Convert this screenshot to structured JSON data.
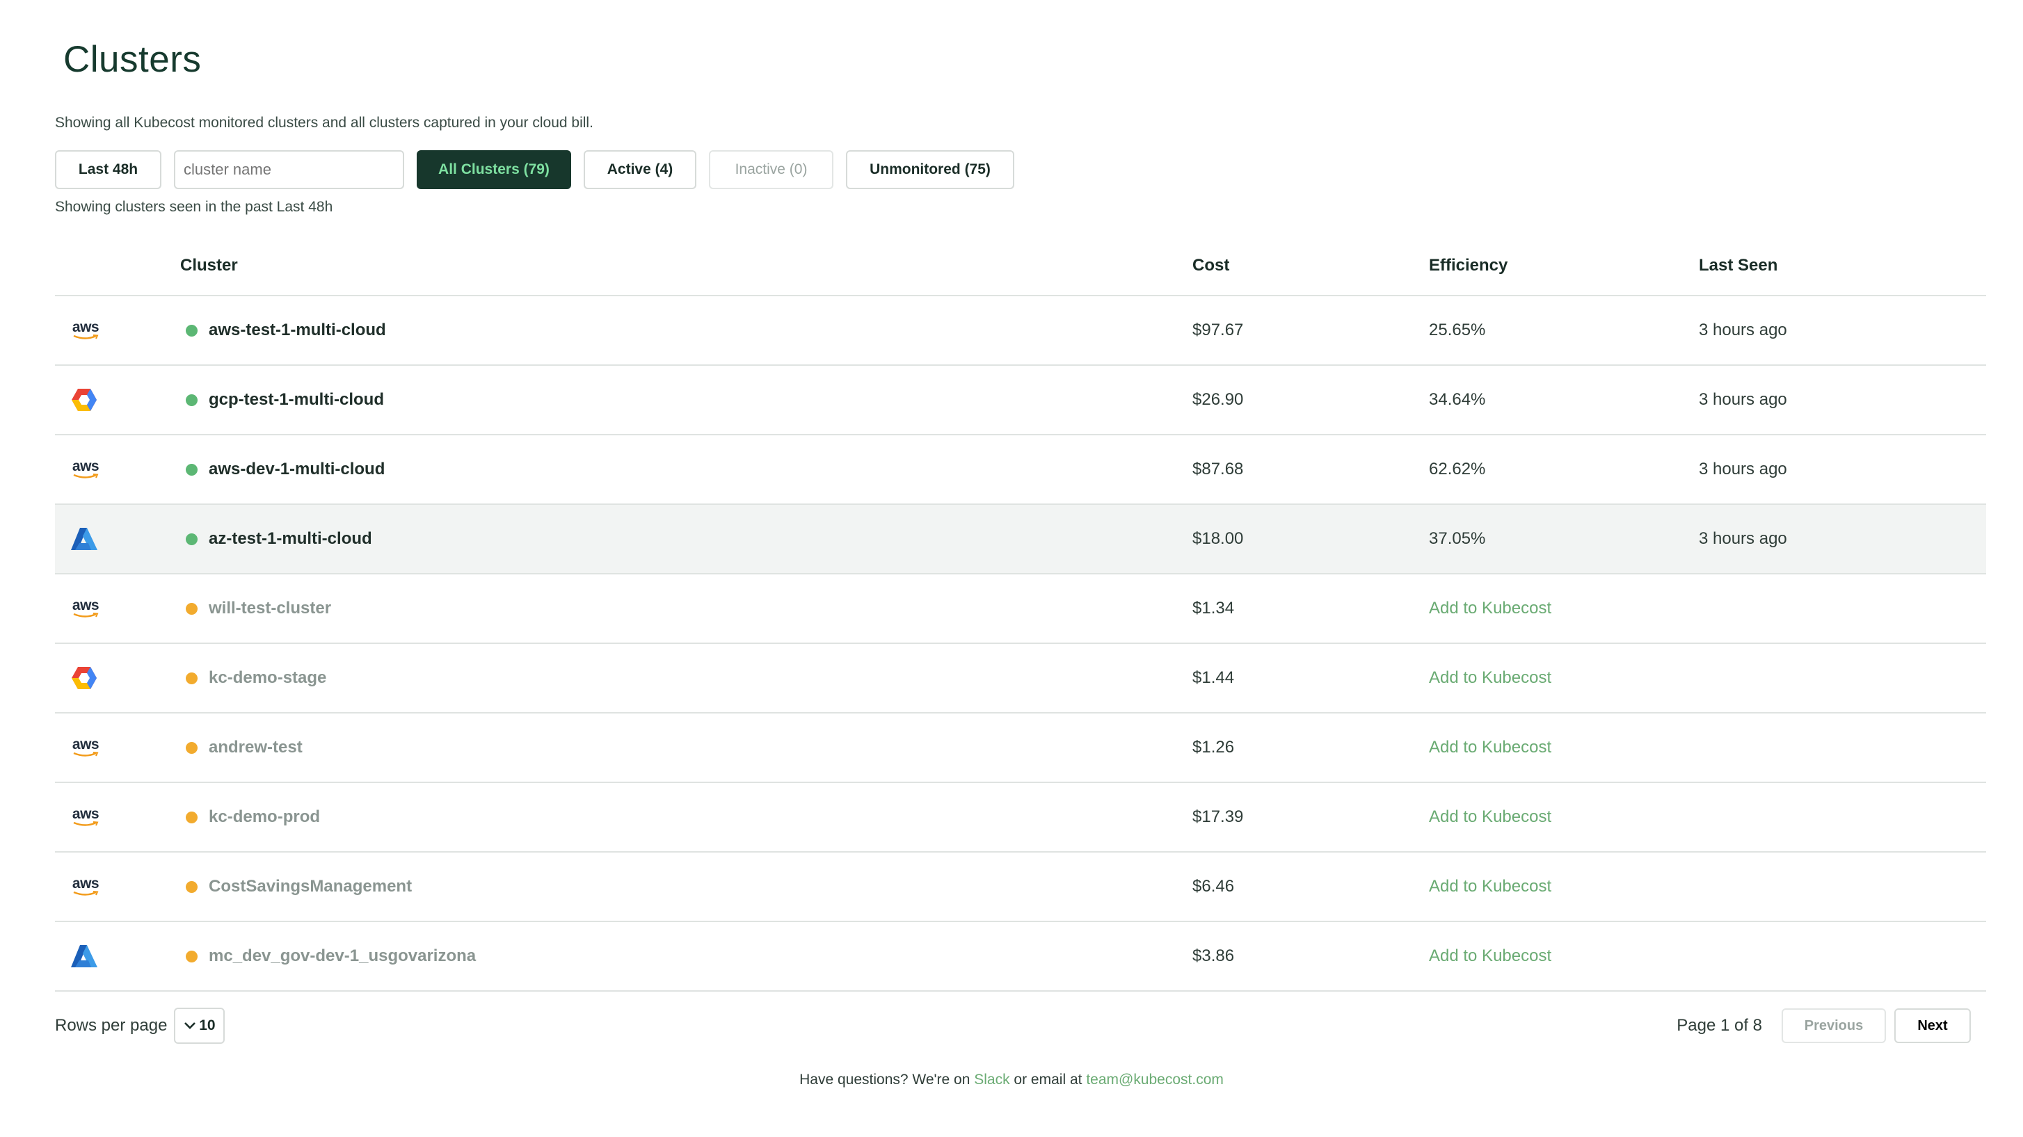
{
  "page": {
    "title": "Clusters",
    "subtitle": "Showing all Kubecost monitored clusters and all clusters captured in your cloud bill.",
    "seen_note": "Showing clusters seen in the past Last 48h"
  },
  "controls": {
    "window_label": "Last 48h",
    "search_placeholder": "cluster name",
    "search_value": "",
    "filters": {
      "all": "All Clusters (79)",
      "active": "Active (4)",
      "inactive": "Inactive (0)",
      "unmonitored": "Unmonitored (75)"
    }
  },
  "table": {
    "headers": {
      "cluster": "Cluster",
      "cost": "Cost",
      "efficiency": "Efficiency",
      "last_seen": "Last Seen"
    },
    "rows": [
      {
        "provider_icon": "aws-logo-icon",
        "status": "green",
        "name": "aws-test-1-multi-cloud",
        "cost": "$97.67",
        "efficiency": "25.65%",
        "last_seen": "3 hours ago",
        "monitored": true
      },
      {
        "provider_icon": "gcp-logo-icon",
        "status": "green",
        "name": "gcp-test-1-multi-cloud",
        "cost": "$26.90",
        "efficiency": "34.64%",
        "last_seen": "3 hours ago",
        "monitored": true
      },
      {
        "provider_icon": "aws-logo-icon",
        "status": "green",
        "name": "aws-dev-1-multi-cloud",
        "cost": "$87.68",
        "efficiency": "62.62%",
        "last_seen": "3 hours ago",
        "monitored": true
      },
      {
        "provider_icon": "azure-logo-icon",
        "status": "green",
        "name": "az-test-1-multi-cloud",
        "cost": "$18.00",
        "efficiency": "37.05%",
        "last_seen": "3 hours ago",
        "monitored": true
      },
      {
        "provider_icon": "aws-logo-icon",
        "status": "orange",
        "name": "will-test-cluster",
        "cost": "$1.34",
        "efficiency": "Add to Kubecost",
        "last_seen": "",
        "monitored": false
      },
      {
        "provider_icon": "gcp-logo-icon",
        "status": "orange",
        "name": "kc-demo-stage",
        "cost": "$1.44",
        "efficiency": "Add to Kubecost",
        "last_seen": "",
        "monitored": false
      },
      {
        "provider_icon": "aws-logo-icon",
        "status": "orange",
        "name": "andrew-test",
        "cost": "$1.26",
        "efficiency": "Add to Kubecost",
        "last_seen": "",
        "monitored": false
      },
      {
        "provider_icon": "aws-logo-icon",
        "status": "orange",
        "name": "kc-demo-prod",
        "cost": "$17.39",
        "efficiency": "Add to Kubecost",
        "last_seen": "",
        "monitored": false
      },
      {
        "provider_icon": "aws-logo-icon",
        "status": "orange",
        "name": "CostSavingsManagement",
        "cost": "$6.46",
        "efficiency": "Add to Kubecost",
        "last_seen": "",
        "monitored": false
      },
      {
        "provider_icon": "azure-logo-icon",
        "status": "orange",
        "name": "mc_dev_gov-dev-1_usgovarizona",
        "cost": "$3.86",
        "efficiency": "Add to Kubecost",
        "last_seen": "",
        "monitored": false
      }
    ]
  },
  "pagination": {
    "rows_per_page_label": "Rows per page",
    "rows_per_page_value": "10",
    "page_info": "Page 1 of 8",
    "previous_label": "Previous",
    "next_label": "Next"
  },
  "help": {
    "prefix": "Have questions? We're on ",
    "slack": "Slack",
    "middle": " or email at ",
    "email": "team@kubecost.com"
  },
  "colors": {
    "primary_dark": "#17372c",
    "accent_green": "#7ee0a1",
    "status_green": "#5cb774",
    "status_orange": "#f2ab2e",
    "link_green": "#6aab73"
  }
}
